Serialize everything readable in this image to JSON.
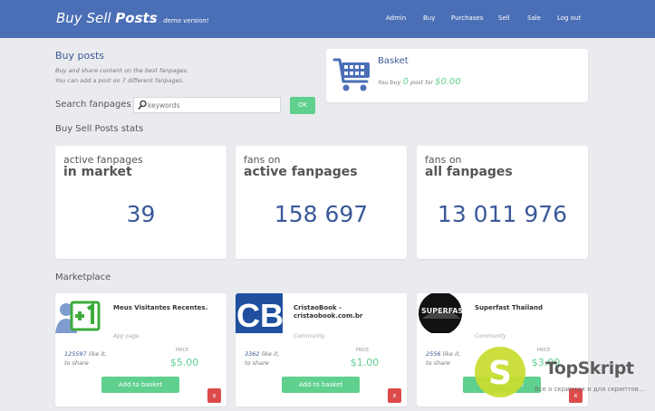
{
  "header": {
    "brand_main": "Buy Sell ",
    "brand_bold": "Posts",
    "brand_demo": ". demo version!",
    "nav": [
      "Admin",
      "Buy",
      "Purchases",
      "Sell",
      "Sale",
      "Log out"
    ]
  },
  "intro": {
    "title": "Buy posts",
    "line1": "Buy and share content on the best fanpages.",
    "line2": "You can add a post on 7 different fanpages."
  },
  "search": {
    "label": "Search fanpages",
    "placeholder": "keywords",
    "button": "OK"
  },
  "basket": {
    "title": "Basket",
    "prefix": "You buy ",
    "count": "0",
    "middle": " post for ",
    "amount": "$0.00"
  },
  "stats": {
    "title": "Buy Sell Posts stats",
    "items": [
      {
        "line1": "active fanpages",
        "line2": "in market",
        "value": "39"
      },
      {
        "line1": "fans on",
        "line2": "active fanpages",
        "value": "158 697"
      },
      {
        "line1": "fans on",
        "line2": "all fanpages",
        "value": "13 011 976"
      }
    ]
  },
  "marketplace": {
    "title": "Marketplace",
    "price_label": "PRICE",
    "add_label": "Add to basket",
    "remove_label": "x",
    "like_suffix": " like it,",
    "share_text": "to share",
    "cards": [
      {
        "name": "Meus Visitantes Recentes.",
        "category": "App page",
        "likes": "125597",
        "price": "$5.00",
        "thumb": "plus-one-icon"
      },
      {
        "name": "CristaoBook - cristaobook.com.br",
        "category": "Community",
        "likes": "3362",
        "price": "$1.00",
        "thumb": "cb-logo"
      },
      {
        "name": "Superfast Thailand",
        "category": "Community",
        "likes": "2556",
        "price": "$3.00",
        "thumb": "superfast-car-photo"
      }
    ]
  },
  "watermark": {
    "name": "TopSkript",
    "tagline": "Все о скриптах и для скриптов..."
  },
  "colors": {
    "header": "#4b6fb6",
    "accent_blue": "#3b5998",
    "green": "#5fd08e",
    "red": "#dc4b4b",
    "background": "#e9ebee"
  }
}
